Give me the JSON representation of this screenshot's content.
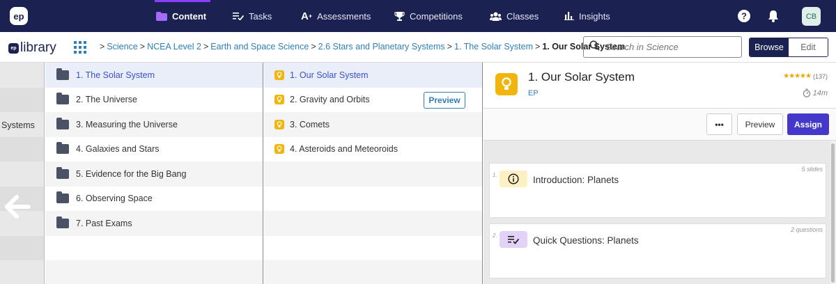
{
  "nav": {
    "logo": "ep",
    "items": [
      {
        "label": "Content",
        "icon": "folder-icon"
      },
      {
        "label": "Tasks",
        "icon": "tasks-icon"
      },
      {
        "label": "Assessments",
        "icon": "assessments-icon"
      },
      {
        "label": "Competitions",
        "icon": "trophy-icon"
      },
      {
        "label": "Classes",
        "icon": "classes-icon"
      },
      {
        "label": "Insights",
        "icon": "insights-icon"
      }
    ],
    "avatar": "CB"
  },
  "subheader": {
    "logo_ep": "ep",
    "logo_text": "library",
    "breadcrumbs": [
      "Science",
      "NCEA Level 2",
      "Earth and Space Science",
      "2.6 Stars and Planetary Systems",
      "1. The Solar System"
    ],
    "current": "1. Our Solar System",
    "search_placeholder": "Search in Science",
    "mode_browse": "Browse",
    "mode_edit": "Edit"
  },
  "leftcol": {
    "label": "Systems"
  },
  "folders": [
    "1. The Solar System",
    "2. The Universe",
    "3. Measuring the Universe",
    "4. Galaxies and Stars",
    "5. Evidence for the Big Bang",
    "6. Observing Space",
    "7. Past Exams"
  ],
  "lessons": [
    "1. Our Solar System",
    "2. Gravity and Orbits",
    "3. Comets",
    "4. Asteroids and Meteoroids"
  ],
  "lesson_preview_label": "Preview",
  "detail": {
    "title": "1. Our Solar System",
    "author": "EP",
    "rating_count": "(137)",
    "duration": "14m",
    "more_label": "•••",
    "preview_label": "Preview",
    "assign_label": "Assign",
    "cards": [
      {
        "num": "1.",
        "title": "Introduction: Planets",
        "meta": "5 slides",
        "icon": "info-icon",
        "color": "#fdf0c2"
      },
      {
        "num": "2.",
        "title": "Quick Questions: Planets",
        "meta": "2 questions",
        "icon": "questions-icon",
        "color": "#e3d2f7"
      }
    ]
  },
  "colors": {
    "nav_bg": "#1b2150",
    "accent": "#4338ca",
    "link": "#2e7fb8",
    "bulb": "#f2b50d"
  }
}
